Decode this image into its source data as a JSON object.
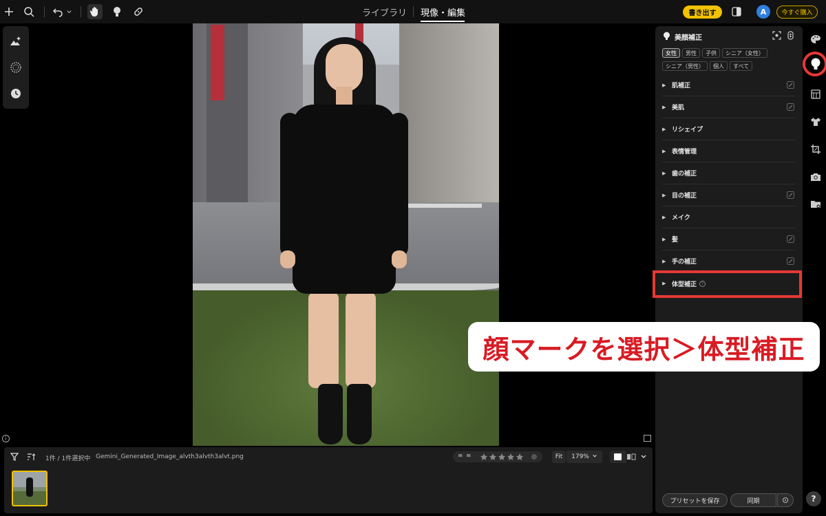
{
  "header": {
    "tabs": [
      {
        "label": "ライブラリ",
        "active": false
      },
      {
        "label": "現像・編集",
        "active": true
      }
    ],
    "export_label": "書き出す",
    "avatar_initial": "A",
    "buy_label": "今すぐ購入",
    "accent_color": "#f2c200"
  },
  "filmstrip": {
    "count_text": "1件 / 1件選択中",
    "filename": "Gemini_Generated_Image_alvth3alvth3alvt.png",
    "fit_label": "Fit",
    "zoom_label": "179%"
  },
  "panel": {
    "title": "美顔補正",
    "chips": [
      "女性",
      "男性",
      "子供",
      "シニア（女性）",
      "シニア（男性）",
      "個人",
      "すべて"
    ],
    "sections": [
      {
        "label": "肌補正",
        "edit": true
      },
      {
        "label": "美肌",
        "edit": true
      },
      {
        "label": "リシェイプ",
        "edit": false
      },
      {
        "label": "表情管理",
        "edit": false
      },
      {
        "label": "歯の補正",
        "edit": false
      },
      {
        "label": "目の補正",
        "edit": true
      },
      {
        "label": "メイク",
        "edit": false
      },
      {
        "label": "髪",
        "edit": true
      },
      {
        "label": "手の補正",
        "edit": true
      },
      {
        "label": "体型補正",
        "edit": false,
        "help": true
      }
    ],
    "preset_label": "プリセットを保存",
    "sync_label": "同期"
  },
  "callout": {
    "text": "顔マークを選択＞体型補正",
    "highlight_color": "#e53935"
  },
  "help_label": "?"
}
